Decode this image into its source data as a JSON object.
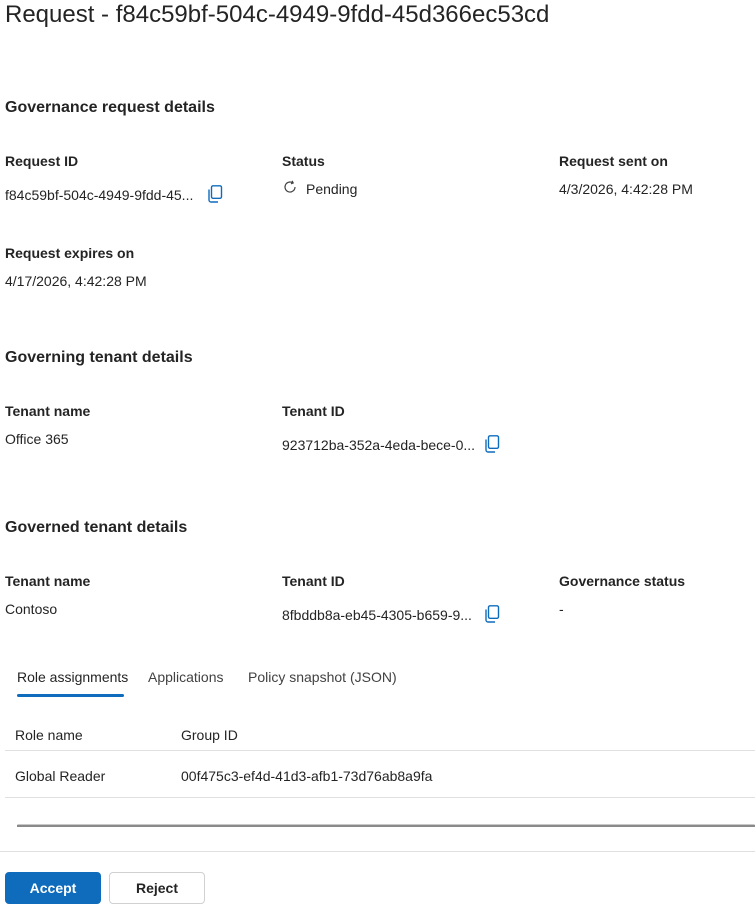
{
  "page": {
    "title": "Request - f84c59bf-504c-4949-9fdd-45d366ec53cd"
  },
  "governance_request": {
    "heading": "Governance request details",
    "request_id_label": "Request ID",
    "request_id_value": "f84c59bf-504c-4949-9fdd-45...",
    "status_label": "Status",
    "status_value": "Pending",
    "sent_label": "Request sent on",
    "sent_value": "4/3/2026, 4:42:28 PM",
    "expires_label": "Request expires on",
    "expires_value": "4/17/2026, 4:42:28 PM"
  },
  "governing_tenant": {
    "heading": "Governing tenant details",
    "name_label": "Tenant name",
    "name_value": "Office 365",
    "id_label": "Tenant ID",
    "id_value": "923712ba-352a-4eda-bece-0..."
  },
  "governed_tenant": {
    "heading": "Governed tenant details",
    "name_label": "Tenant name",
    "name_value": "Contoso",
    "id_label": "Tenant ID",
    "id_value": "8fbddb8a-eb45-4305-b659-9...",
    "status_label": "Governance status",
    "status_value": "-"
  },
  "tabs": [
    {
      "label": "Role assignments",
      "selected": true
    },
    {
      "label": "Applications",
      "selected": false
    },
    {
      "label": "Policy snapshot (JSON)",
      "selected": false
    }
  ],
  "role_table": {
    "columns": [
      "Role name",
      "Group ID"
    ],
    "rows": [
      [
        "Global Reader",
        "00f475c3-ef4d-41d3-afb1-73d76ab8a9fa"
      ]
    ]
  },
  "actions": {
    "accept_label": "Accept",
    "reject_label": "Reject"
  },
  "colors": {
    "accent": "#0f6cbd",
    "text": "#242424",
    "divider": "#e0e0e0"
  },
  "icons": {
    "copy": "copy-icon",
    "status_pending": "pending-spinner-icon"
  }
}
